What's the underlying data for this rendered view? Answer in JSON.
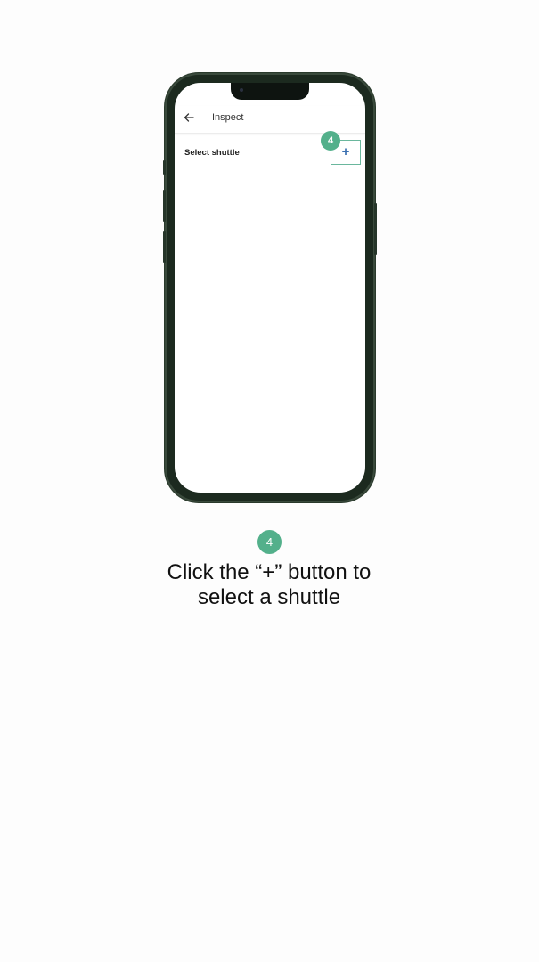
{
  "app": {
    "header_title": "Inspect",
    "section_label": "Select shuttle",
    "add_button_label": "+"
  },
  "step": {
    "number": "4",
    "caption_line1": "Click the “+” button to",
    "caption_line2": "select a shuttle"
  },
  "colors": {
    "accent_green": "#53b08b",
    "plus_blue": "#3a6fb0",
    "highlight_border": "#6ab79d"
  },
  "icons": {
    "back": "back-arrow-icon"
  }
}
